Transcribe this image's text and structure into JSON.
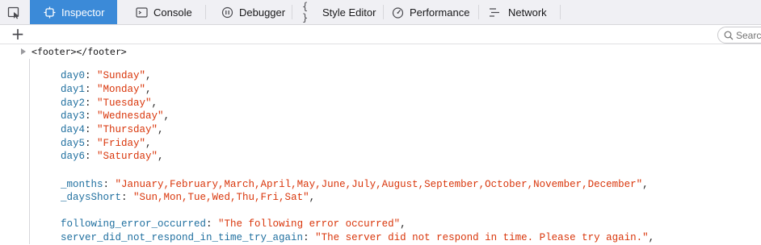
{
  "toolbar": {
    "tabs": [
      {
        "label": "Inspector",
        "icon": "inspector-icon",
        "active": true
      },
      {
        "label": "Console",
        "icon": "console-icon",
        "active": false
      },
      {
        "label": "Debugger",
        "icon": "debugger-icon",
        "active": false
      },
      {
        "label": "Style Editor",
        "icon": "style-editor-icon",
        "active": false
      },
      {
        "label": "Performance",
        "icon": "performance-icon",
        "active": false
      },
      {
        "label": "Network",
        "icon": "network-icon",
        "active": false
      }
    ],
    "active_color": "#3b8ad8"
  },
  "search": {
    "placeholder": "Search"
  },
  "markup": {
    "node": "<footer></footer>"
  },
  "days": [
    {
      "key": "day0",
      "value": "\"Sunday\""
    },
    {
      "key": "day1",
      "value": "\"Monday\""
    },
    {
      "key": "day2",
      "value": "\"Tuesday\""
    },
    {
      "key": "day3",
      "value": "\"Wednesday\""
    },
    {
      "key": "day4",
      "value": "\"Thursday\""
    },
    {
      "key": "day5",
      "value": "\"Friday\""
    },
    {
      "key": "day6",
      "value": "\"Saturday\""
    }
  ],
  "months": {
    "key": "_months",
    "value": "\"January,February,March,April,May,June,July,August,September,October,November,December\""
  },
  "days_short": {
    "key": "_daysShort",
    "value": "\"Sun,Mon,Tue,Wed,Thu,Fri,Sat\""
  },
  "error1": {
    "key": "following_error_occurred",
    "value": "\"The following error occurred\""
  },
  "error2": {
    "key": "server_did_not_respond_in_time_try_again",
    "value": "\"The server did not respond in time. Please try again.\""
  }
}
